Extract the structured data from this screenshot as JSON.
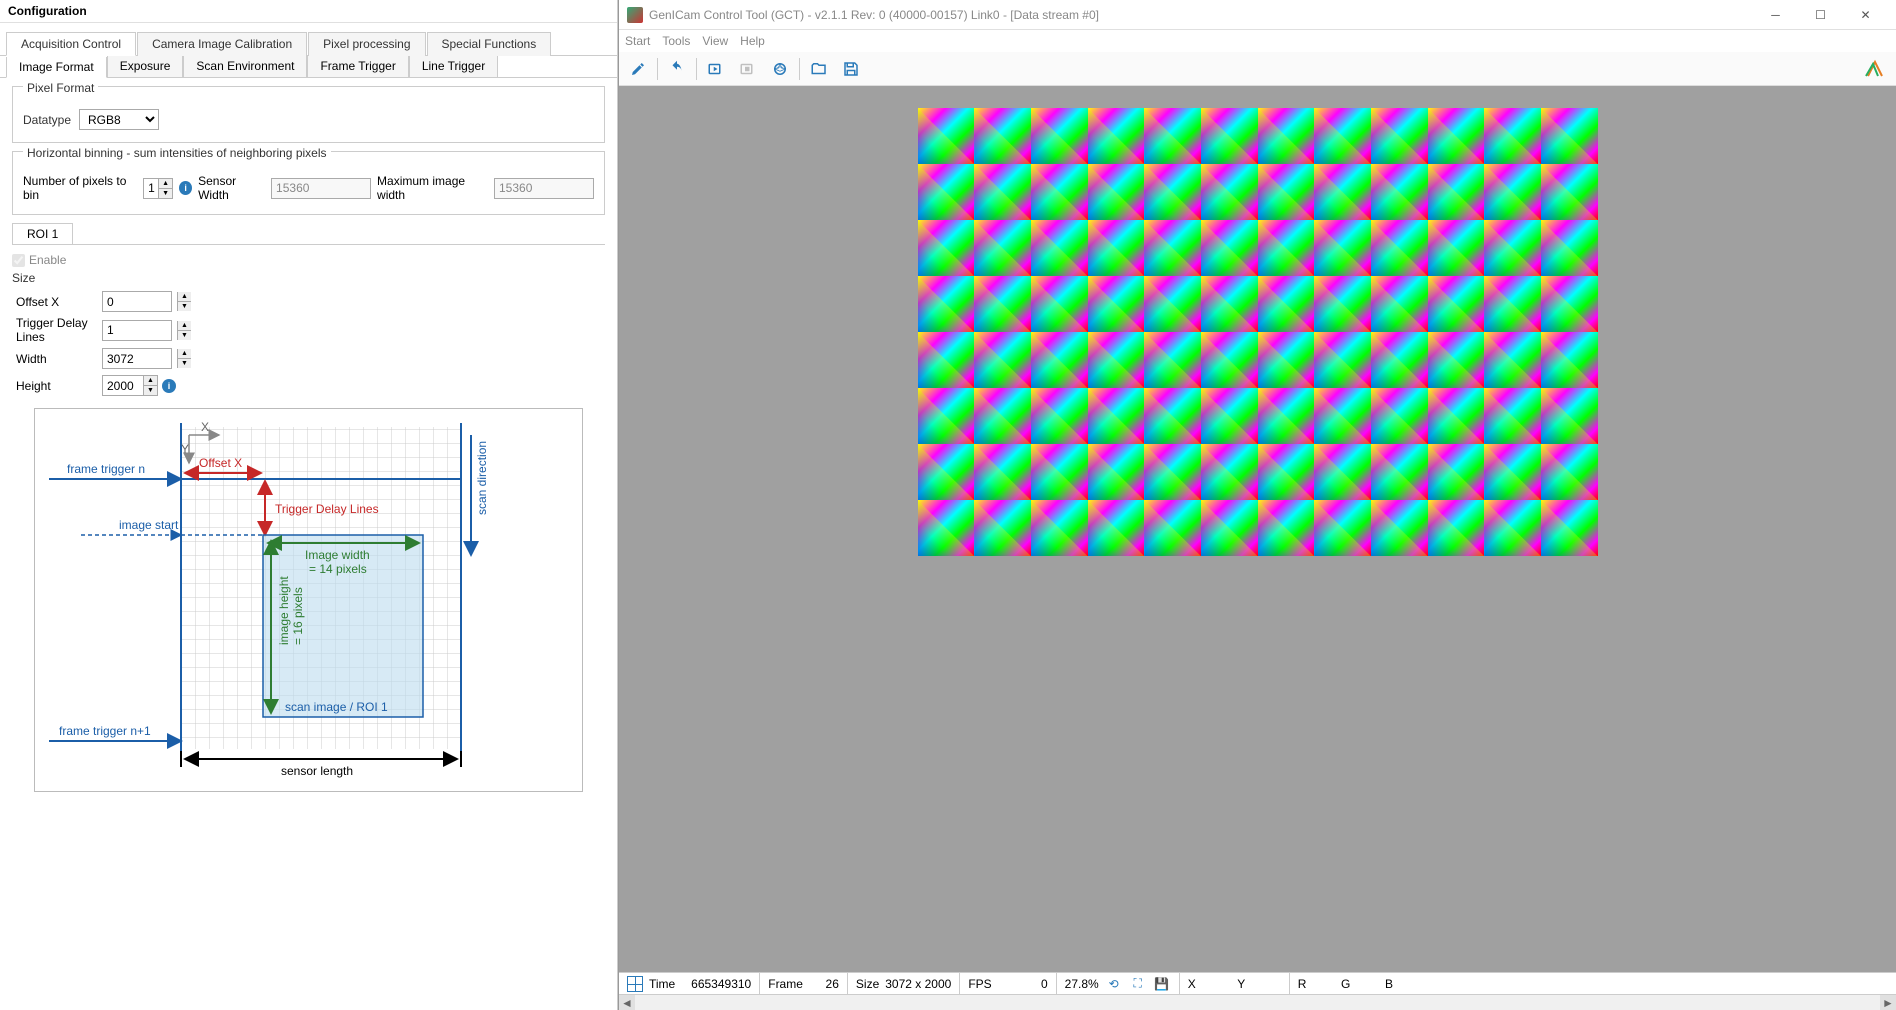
{
  "left": {
    "title": "Configuration",
    "tabs": [
      "Acquisition Control",
      "Camera Image Calibration",
      "Pixel processing",
      "Special Functions"
    ],
    "active_tab": 0,
    "subtabs": [
      "Image Format",
      "Exposure",
      "Scan Environment",
      "Frame Trigger",
      "Line Trigger"
    ],
    "active_subtab": 0,
    "pixel_format": {
      "legend": "Pixel Format",
      "datatype_label": "Datatype",
      "datatype_value": "RGB8"
    },
    "binning": {
      "legend": "Horizontal binning - sum intensities of neighboring pixels",
      "num_label": "Number of pixels to bin",
      "num_value": "1",
      "sensor_width_label": "Sensor Width",
      "sensor_width_value": "15360",
      "max_width_label": "Maximum image width",
      "max_width_value": "15360"
    },
    "roi_tab": "ROI 1",
    "enable_label": "Enable",
    "size_label": "Size",
    "size": {
      "offset_x_label": "Offset X",
      "offset_x_value": "0",
      "trigger_delay_label": "Trigger Delay Lines",
      "trigger_delay_value": "1",
      "width_label": "Width",
      "width_value": "3072",
      "height_label": "Height",
      "height_value": "2000"
    },
    "diagram": {
      "frame_trigger_n": "frame trigger n",
      "image_start": "image start",
      "frame_trigger_n1": "frame trigger n+1",
      "offset_x": "Offset X",
      "trigger_delay_lines": "Trigger Delay Lines",
      "image_width": "Image width",
      "image_width_val": "= 14 pixels",
      "image_height": "image height",
      "image_height_val": "= 16 pixels",
      "scan_image": "scan image / ROI 1",
      "sensor_length": "sensor length",
      "scan_direction": "scan direction",
      "x_axis": "X",
      "y_axis": "Y"
    }
  },
  "right": {
    "title": "GenICam Control Tool (GCT) - v2.1.1 Rev: 0   (40000-00157) Link0   - [Data stream #0]",
    "menu": [
      "Start",
      "Tools",
      "View",
      "Help"
    ],
    "status": {
      "time_label": "Time",
      "time_value": "665349310",
      "frame_label": "Frame",
      "frame_value": "26",
      "size_label": "Size",
      "size_value": "3072 x 2000",
      "fps_label": "FPS",
      "fps_value": "0",
      "zoom": "27.8%",
      "x_label": "X",
      "y_label": "Y",
      "r_label": "R",
      "g_label": "G",
      "b_label": "B"
    }
  }
}
